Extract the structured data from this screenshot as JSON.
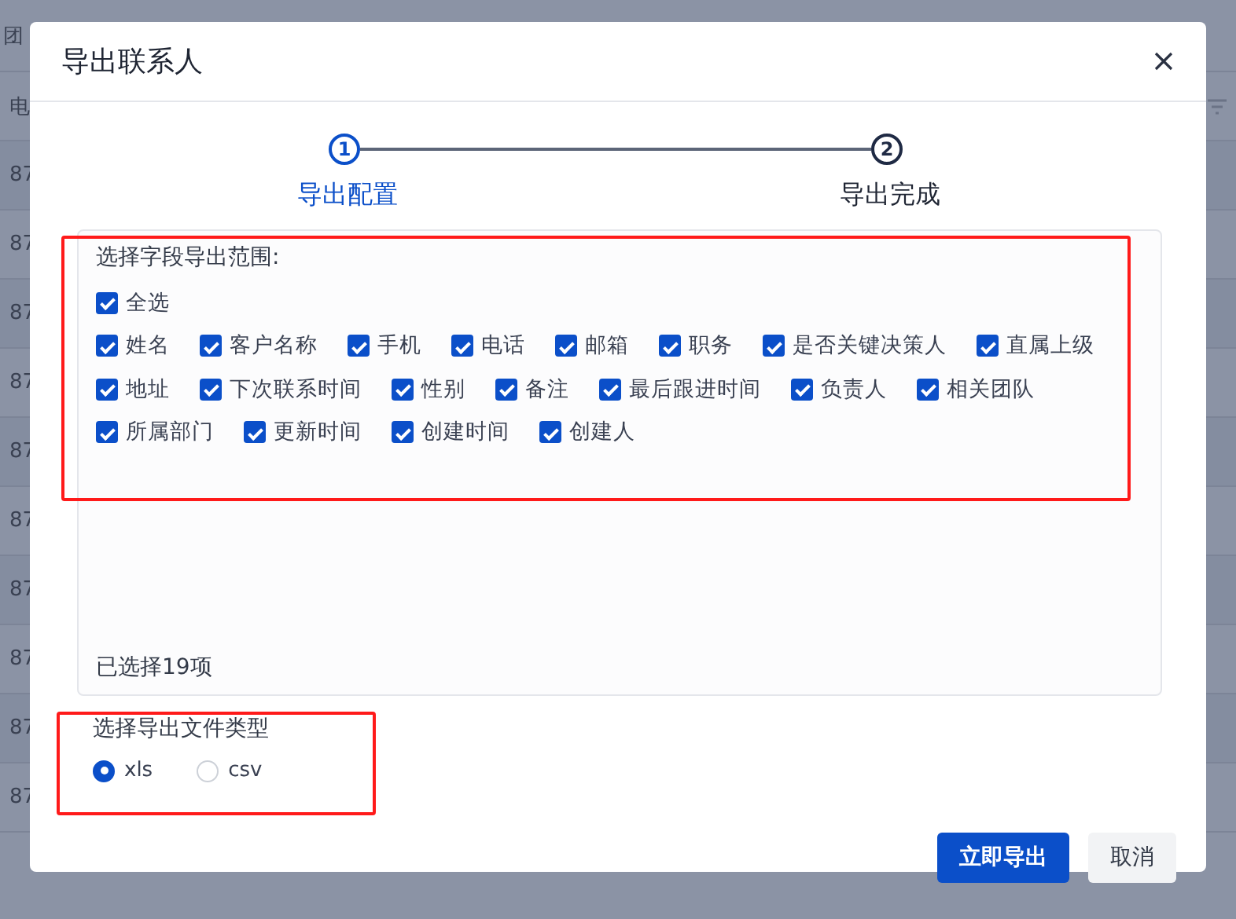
{
  "background_table": {
    "toolbar_text": "团",
    "header": "电",
    "column_1": [
      "87",
      "87",
      "87",
      "87",
      "87",
      "87",
      "87",
      "87",
      "87",
      "87"
    ]
  },
  "dialog": {
    "title": "导出联系人",
    "steps": [
      {
        "number": "1",
        "label": "导出配置",
        "selected": true
      },
      {
        "number": "2",
        "label": "导出完成",
        "selected": false
      }
    ],
    "field_section": {
      "title": "选择字段导出范围:",
      "select_all": {
        "label": "全选",
        "checked": true
      },
      "fields": [
        {
          "label": "姓名",
          "checked": true
        },
        {
          "label": "客户名称",
          "checked": true
        },
        {
          "label": "手机",
          "checked": true
        },
        {
          "label": "电话",
          "checked": true
        },
        {
          "label": "邮箱",
          "checked": true
        },
        {
          "label": "职务",
          "checked": true
        },
        {
          "label": "是否关键决策人",
          "checked": true
        },
        {
          "label": "直属上级",
          "checked": true
        },
        {
          "label": "地址",
          "checked": true
        },
        {
          "label": "下次联系时间",
          "checked": true
        },
        {
          "label": "性别",
          "checked": true
        },
        {
          "label": "备注",
          "checked": true
        },
        {
          "label": "最后跟进时间",
          "checked": true
        },
        {
          "label": "负责人",
          "checked": true
        },
        {
          "label": "相关团队",
          "checked": true
        },
        {
          "label": "所属部门",
          "checked": true
        },
        {
          "label": "更新时间",
          "checked": true
        },
        {
          "label": "创建时间",
          "checked": true
        },
        {
          "label": "创建人",
          "checked": true
        }
      ],
      "selected_count": "已选择19项"
    },
    "file_type": {
      "title": "选择导出文件类型",
      "options": [
        {
          "label": "xls",
          "selected": true
        },
        {
          "label": "csv",
          "selected": false
        }
      ]
    },
    "buttons": [
      {
        "label": "立即导出",
        "kind": "primary"
      },
      {
        "label": "取消",
        "kind": "secondary"
      }
    ]
  }
}
